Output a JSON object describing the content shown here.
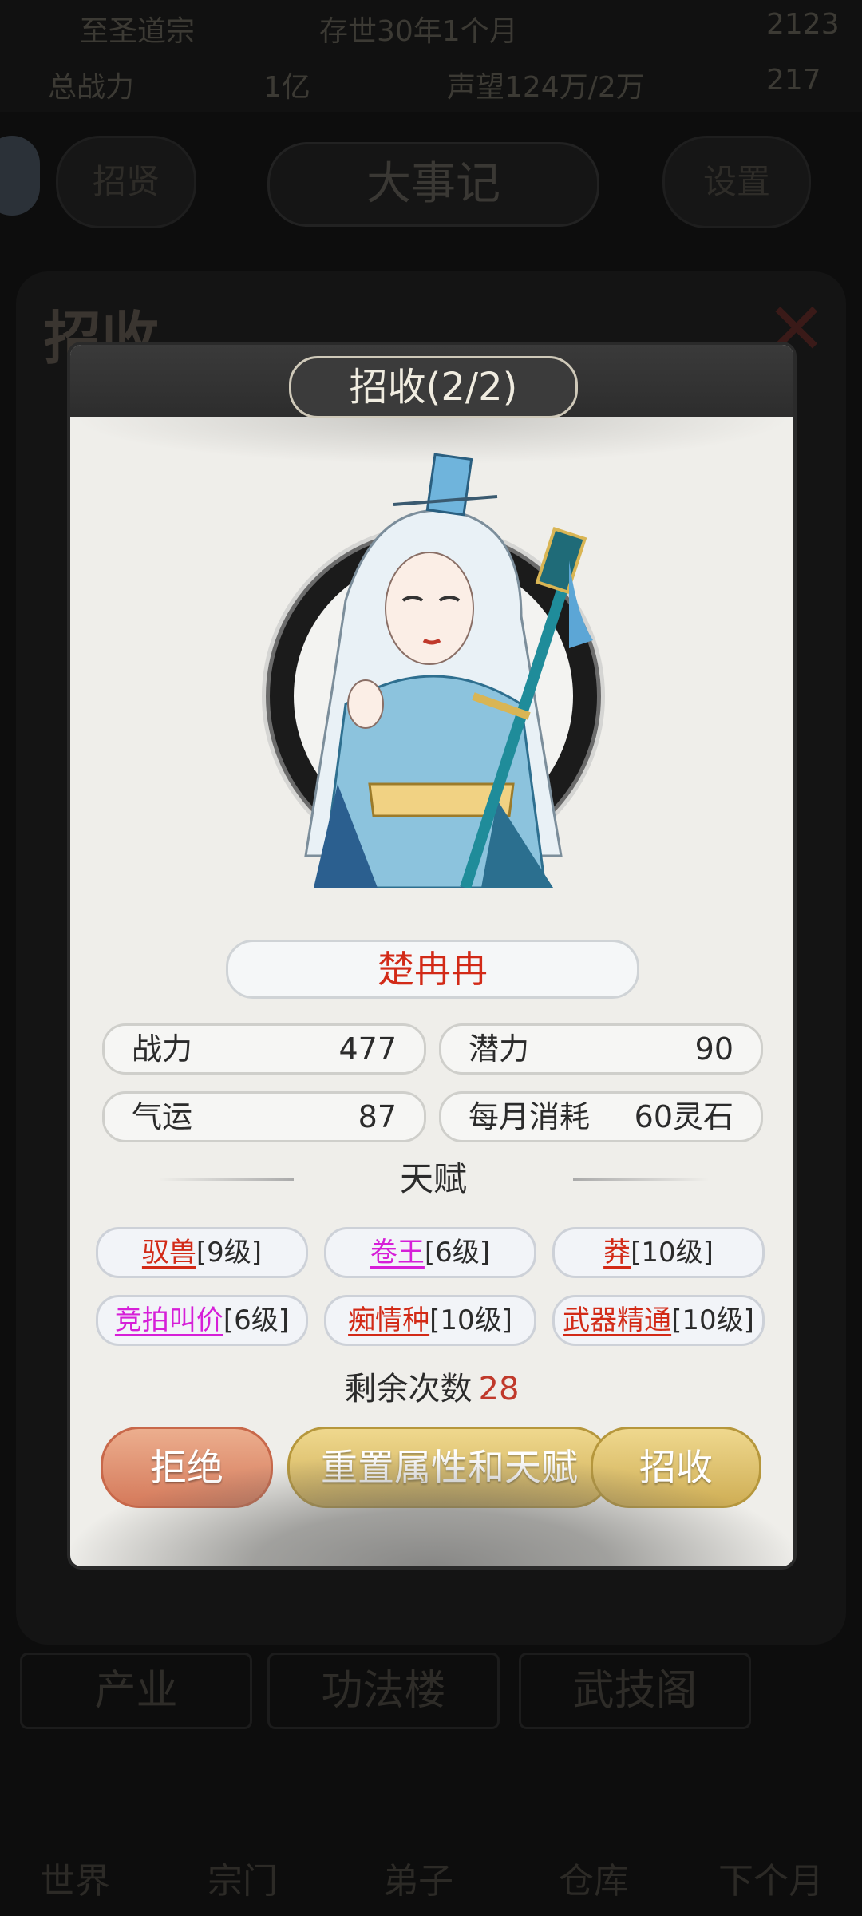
{
  "background": {
    "top_left_label": "至圣道宗",
    "time_label": "存世30年1个月",
    "resource_1": "2123",
    "power_label": "总战力",
    "power_value": "1亿",
    "prestige_label": "声望124万/2万",
    "resource_2": "217",
    "header_title": "大事记",
    "left_button": "招贤",
    "right_button": "设置",
    "panel_title": "招收",
    "tabs": [
      "产业",
      "功法楼",
      "武技阁"
    ],
    "nav": [
      "世界",
      "宗门",
      "弟子",
      "仓库",
      "下个月"
    ]
  },
  "modal": {
    "title": "招收(2/2)",
    "name": "楚冉冉",
    "stats": [
      {
        "key": "战力",
        "value": "477"
      },
      {
        "key": "潜力",
        "value": "90"
      },
      {
        "key": "气运",
        "value": "87"
      },
      {
        "key": "每月消耗",
        "value": "60灵石"
      }
    ],
    "talent_header": "天赋",
    "talents": [
      {
        "name": "驭兽",
        "level": "[9级]",
        "color": "red"
      },
      {
        "name": "卷王",
        "level": "[6级]",
        "color": "magenta"
      },
      {
        "name": "莽",
        "level": "[10级]",
        "color": "red"
      },
      {
        "name": "竞拍叫价",
        "level": "[6级]",
        "color": "magenta"
      },
      {
        "name": "痴情种",
        "level": "[10级]",
        "color": "red"
      },
      {
        "name": "武器精通",
        "level": "[10级]",
        "color": "red"
      }
    ],
    "remaining_label": "剩余次数",
    "remaining_value": "28",
    "buttons": {
      "reject": "拒绝",
      "reset": "重置属性和天赋",
      "recruit": "招收"
    }
  }
}
